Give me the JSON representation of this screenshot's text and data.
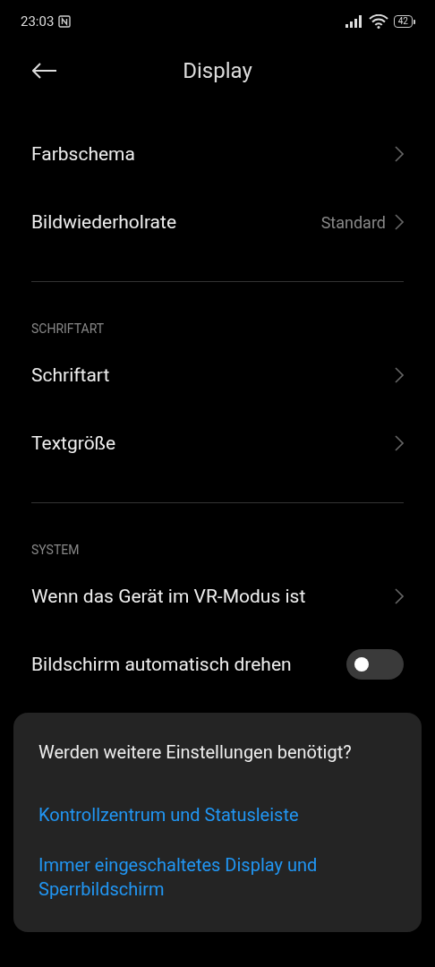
{
  "status_bar": {
    "time": "23:03",
    "battery": "42"
  },
  "header": {
    "title": "Display"
  },
  "sections": [
    {
      "rows": [
        {
          "kind": "link",
          "label": "Farbschema"
        },
        {
          "kind": "link",
          "label": "Bildwiederholrate",
          "value": "Standard"
        }
      ]
    },
    {
      "title": "SCHRIFTART",
      "rows": [
        {
          "kind": "link",
          "label": "Schriftart"
        },
        {
          "kind": "link",
          "label": "Textgröße"
        }
      ]
    },
    {
      "title": "SYSTEM",
      "rows": [
        {
          "kind": "link",
          "label": "Wenn das Gerät im VR-Modus ist"
        },
        {
          "kind": "toggle",
          "label": "Bildschirm automatisch drehen",
          "on": false
        }
      ]
    }
  ],
  "card": {
    "question": "Werden weitere Einstellungen benötigt?",
    "links": [
      "Kontrollzentrum und Statusleiste",
      "Immer eingeschaltetes Display und Sperrbildschirm"
    ]
  }
}
